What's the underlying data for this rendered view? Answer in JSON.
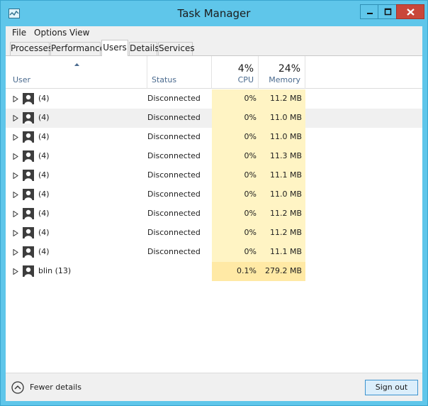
{
  "window": {
    "title": "Task Manager"
  },
  "menu": [
    "File",
    "Options",
    "View"
  ],
  "tabs": [
    "Processes",
    "Performance",
    "Users",
    "Details",
    "Services"
  ],
  "active_tab": "Users",
  "columns": {
    "user": "User",
    "status": "Status",
    "cpu": {
      "label": "CPU",
      "total": "4%"
    },
    "memory": {
      "label": "Memory",
      "total": "24%"
    }
  },
  "rows": [
    {
      "user": "(4)",
      "status": "Disconnected",
      "cpu": "0%",
      "memory": "11.2 MB"
    },
    {
      "user": "(4)",
      "status": "Disconnected",
      "cpu": "0%",
      "memory": "11.0 MB"
    },
    {
      "user": "(4)",
      "status": "Disconnected",
      "cpu": "0%",
      "memory": "11.0 MB"
    },
    {
      "user": "(4)",
      "status": "Disconnected",
      "cpu": "0%",
      "memory": "11.3 MB"
    },
    {
      "user": "(4)",
      "status": "Disconnected",
      "cpu": "0%",
      "memory": "11.1 MB"
    },
    {
      "user": "(4)",
      "status": "Disconnected",
      "cpu": "0%",
      "memory": "11.0 MB"
    },
    {
      "user": "(4)",
      "status": "Disconnected",
      "cpu": "0%",
      "memory": "11.2 MB"
    },
    {
      "user": "(4)",
      "status": "Disconnected",
      "cpu": "0%",
      "memory": "11.2 MB"
    },
    {
      "user": "(4)",
      "status": "Disconnected",
      "cpu": "0%",
      "memory": "11.1 MB"
    },
    {
      "user": "blin (13)",
      "status": "",
      "cpu": "0.1%",
      "memory": "279.2 MB"
    }
  ],
  "footer": {
    "fewer_details": "Fewer details",
    "sign_out": "Sign out"
  },
  "colors": {
    "titlebar": "#5fc6ea",
    "close": "#c9473a",
    "heat_light": "#fff4c4",
    "heat_dark": "#ffe9a5",
    "accent": "#3c93cf"
  },
  "icons": [
    "task-manager-app-icon",
    "minimize-icon",
    "maximize-icon",
    "close-icon",
    "sort-up-icon",
    "expand-chevron-icon",
    "user-avatar-icon",
    "fewer-details-chevron-icon"
  ]
}
